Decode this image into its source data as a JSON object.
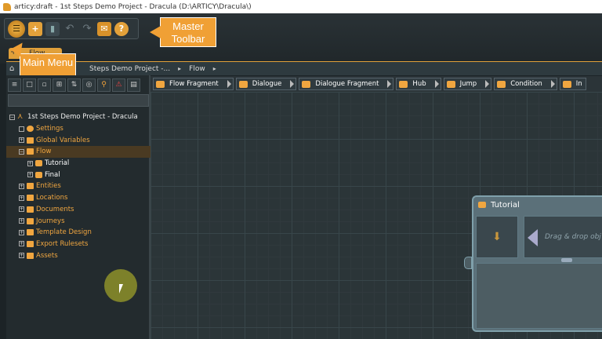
{
  "window": {
    "title": "articy:draft - 1st Steps Demo Project - Dracula (D:\\ARTICY\\Dracula\\)"
  },
  "callouts": {
    "master_toolbar": "Master Toolbar",
    "main_menu": "Main Menu"
  },
  "tab": {
    "label": "Flow"
  },
  "breadcrumb": {
    "project": "Steps Demo Project -...",
    "current": "Flow"
  },
  "templates": [
    {
      "label": "Flow Fragment",
      "icon": "flow-fragment-icon"
    },
    {
      "label": "Dialogue",
      "icon": "dialogue-icon"
    },
    {
      "label": "Dialogue Fragment",
      "icon": "dialogue-fragment-icon"
    },
    {
      "label": "Hub",
      "icon": "hub-icon"
    },
    {
      "label": "Jump",
      "icon": "jump-icon"
    },
    {
      "label": "Condition",
      "icon": "condition-icon"
    },
    {
      "label": "In",
      "icon": "instruction-icon"
    }
  ],
  "tree": {
    "root": "1st Steps Demo Project - Dracula",
    "items": [
      {
        "label": "Settings",
        "icon": "gear-icon"
      },
      {
        "label": "Global Variables",
        "icon": "variables-icon"
      },
      {
        "label": "Flow",
        "icon": "flow-icon"
      },
      {
        "label": "Tutorial",
        "icon": "flow-fragment-icon"
      },
      {
        "label": "Final",
        "icon": "flow-fragment-icon"
      },
      {
        "label": "Entities",
        "icon": "entities-icon"
      },
      {
        "label": "Locations",
        "icon": "locations-icon"
      },
      {
        "label": "Documents",
        "icon": "documents-icon"
      },
      {
        "label": "Journeys",
        "icon": "journeys-icon"
      },
      {
        "label": "Template Design",
        "icon": "template-icon"
      },
      {
        "label": "Export Rulesets",
        "icon": "export-icon"
      },
      {
        "label": "Assets",
        "icon": "assets-icon"
      }
    ]
  },
  "node": {
    "title": "Tutorial",
    "drop_placeholder": "Drag & drop obj"
  },
  "colors": {
    "accent": "#f0a640",
    "callout": "#f0a035",
    "canvas": "#2b3538"
  }
}
